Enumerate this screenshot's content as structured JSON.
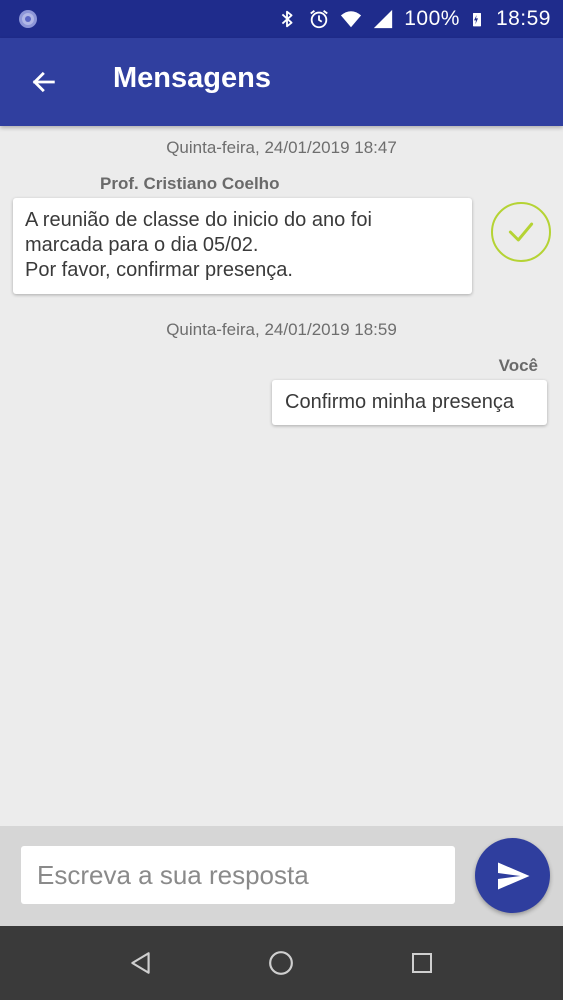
{
  "status_bar": {
    "battery_text": "100%",
    "time": "18:59",
    "icons": [
      "app-notification-icon",
      "bluetooth-icon",
      "alarm-icon",
      "wifi-icon",
      "cell-signal-icon",
      "battery-charging-icon"
    ]
  },
  "app_bar": {
    "title": "Mensagens",
    "back_icon": "arrow-back-icon"
  },
  "messages": [
    {
      "date": "Quinta-feira, 24/01/2019 18:47",
      "sender": "Prof. Cristiano Coelho",
      "lines": [
        "A reunião de classe do inicio do ano foi",
        "marcada para o dia 05/02.",
        "Por favor, confirmar presença."
      ],
      "confirm_icon": "check-circle-icon"
    },
    {
      "date": "Quinta-feira, 24/01/2019 18:59",
      "sender": "Você",
      "lines": [
        "Confirmo minha presença"
      ]
    }
  ],
  "composer": {
    "placeholder": "Escreva a sua resposta",
    "value": "",
    "send_icon": "send-icon"
  },
  "nav_bar": {
    "icons": [
      "nav-back-icon",
      "nav-home-icon",
      "nav-recents-icon"
    ]
  },
  "colors": {
    "status_bar": "#1f2c8c",
    "app_bar": "#303f9f",
    "confirm_accent": "#b5d334",
    "send_button": "#2f3e9e"
  }
}
